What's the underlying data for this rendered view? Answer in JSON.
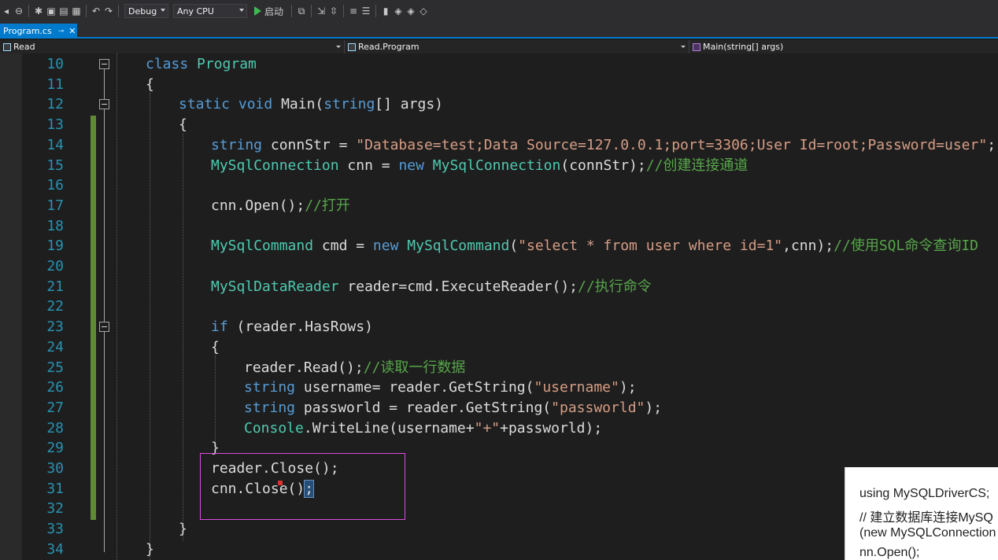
{
  "toolbar": {
    "config": "Debug",
    "platform": "Any CPU",
    "run_label": "启动"
  },
  "tab": {
    "filename": "Program.cs",
    "pin_glyph": "⊸",
    "close_glyph": "✕"
  },
  "navbar": {
    "project": "Read",
    "type": "Read.Program",
    "member": "Main(string[] args)"
  },
  "code": {
    "line_numbers": [
      "10",
      "11",
      "12",
      "13",
      "14",
      "15",
      "16",
      "17",
      "18",
      "19",
      "20",
      "21",
      "22",
      "23",
      "24",
      "25",
      "26",
      "27",
      "28",
      "29",
      "30",
      "31",
      "32",
      "33",
      "34"
    ],
    "l10_kw": "class",
    "l10_ty": "Program",
    "l11": "{",
    "l12_kw1": "static",
    "l12_kw2": "void",
    "l12_name": "Main(",
    "l12_kw3": "string",
    "l12_rest": "[] args)",
    "l13": "{",
    "l14_kw": "string",
    "l14_mid": "connStr = ",
    "l14_str": "\"Database=test;Data Source=127.0.0.1;port=3306;User Id=root;Password=user\"",
    "l14_end": ";",
    "l15_ty": "MySqlConnection",
    "l15_mid": "cnn = ",
    "l15_kw": "new",
    "l15_ty2": "MySqlConnection",
    "l15_rest": "(connStr);",
    "l15_cm": "//创建连接通道",
    "l17_code": "cnn.Open();",
    "l17_cm": "//打开",
    "l19_ty": "MySqlCommand",
    "l19_mid": "cmd = ",
    "l19_kw": "new",
    "l19_ty2": "MySqlCommand",
    "l19_open": "(",
    "l19_str": "\"select * from user where id=1\"",
    "l19_rest": ",cnn);",
    "l19_cm": "//使用SQL命令查询ID",
    "l21_ty": "MySqlDataReader",
    "l21_rest": "reader=cmd.ExecuteReader();",
    "l21_cm": "//执行命令",
    "l23_kw": "if",
    "l23_rest": "(reader.HasRows)",
    "l24": "{",
    "l25_code": "reader.Read();",
    "l25_cm": "//读取一行数据",
    "l26_kw": "string",
    "l26_mid": "username= reader.GetString(",
    "l26_str": "\"username\"",
    "l26_end": ");",
    "l27_kw": "string",
    "l27_mid": "passworld = reader.GetString(",
    "l27_str": "\"passworld\"",
    "l27_end": ");",
    "l28_ty": "Console",
    "l28_mid": ".WriteLine(username+",
    "l28_str": "\"+\"",
    "l28_end": "+passworld);",
    "l29": "}",
    "l30": "reader.Close();",
    "l31_a": "cnn.Close()",
    "l31_b": ";",
    "l33": "}",
    "l34": "}"
  },
  "tooltip": {
    "lines": [
      "using MySQLDriverCS;",
      "// 建立数据库连接MySQ",
      "(new MySQLConnection",
      "nn.Open();"
    ]
  }
}
